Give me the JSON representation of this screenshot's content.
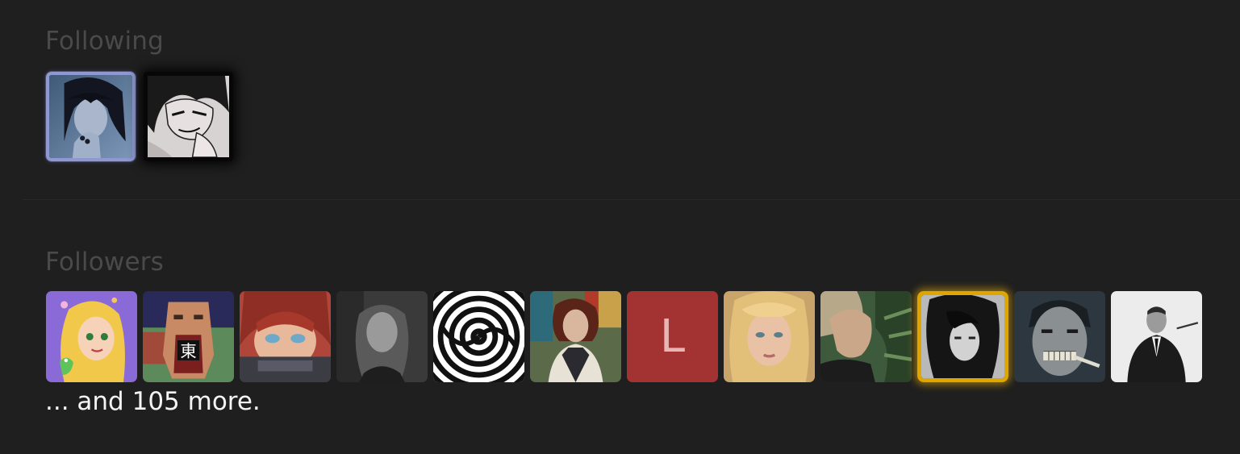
{
  "following": {
    "title": "Following",
    "avatars": [
      {
        "icon": "user-avatar-dark-haired-woman-icon",
        "frame": "blue"
      },
      {
        "icon": "user-avatar-manga-character-icon",
        "frame": "dark"
      }
    ]
  },
  "followers": {
    "title": "Followers",
    "avatars": [
      {
        "icon": "user-avatar-cartoon-princess-icon"
      },
      {
        "icon": "user-avatar-lowpoly-face-icon",
        "badge_text": "東"
      },
      {
        "icon": "user-avatar-anime-girl-icon"
      },
      {
        "icon": "user-avatar-monochrome-portrait-icon"
      },
      {
        "icon": "user-avatar-spiral-icon"
      },
      {
        "icon": "user-avatar-redhead-woman-icon"
      },
      {
        "icon": "user-avatar-letter-icon",
        "letter": "L",
        "color": "#a33333"
      },
      {
        "icon": "user-avatar-blonde-woman-icon"
      },
      {
        "icon": "user-avatar-jungle-profile-icon"
      },
      {
        "icon": "user-avatar-black-hair-woman-icon",
        "frame": "gold"
      },
      {
        "icon": "user-avatar-grinning-man-icon"
      },
      {
        "icon": "user-avatar-man-in-suit-icon"
      }
    ],
    "more_text": "... and 105 more."
  },
  "colors": {
    "background": "#1f1f1f",
    "section_title": "#4a4a4a",
    "text": "#f4f4f4",
    "frame_blue": "#8f98cf",
    "frame_gold": "#e0a600",
    "letter_avatar": "#a33333"
  }
}
